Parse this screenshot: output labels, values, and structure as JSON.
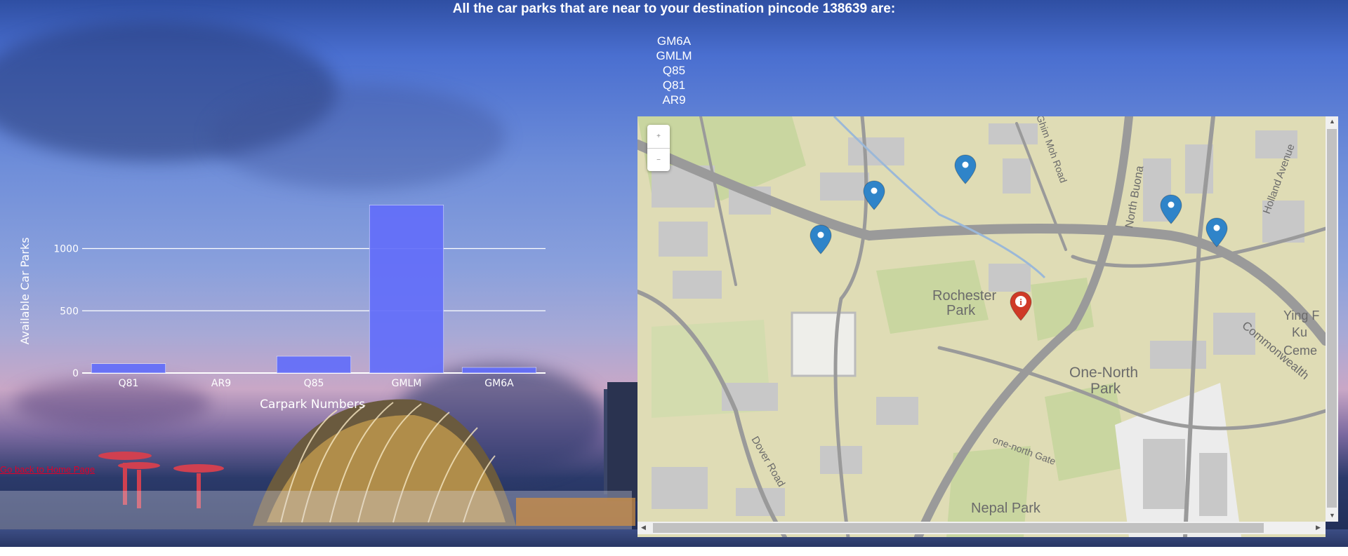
{
  "page": {
    "heading": "All the car parks that are near to your destination pincode 138639 are:",
    "carparks": [
      "GM6A",
      "GMLM",
      "Q85",
      "Q81",
      "AR9"
    ],
    "home_link": "Go back to Home Page"
  },
  "chart_data": {
    "type": "bar",
    "categories": [
      "Q81",
      "AR9",
      "Q85",
      "GMLM",
      "GM6A"
    ],
    "values": [
      75,
      0,
      135,
      1350,
      45
    ],
    "xlabel": "Carpark Numbers",
    "ylabel": "Available Car Parks",
    "yticks": [
      0,
      500,
      1000
    ],
    "ylim": [
      0,
      1420
    ],
    "grid": true,
    "bar_color": "#636efa"
  },
  "map": {
    "labels": {
      "rochester1": "Rochester",
      "rochester2": "Park",
      "onenorth1": "One-North",
      "onenorth2": "Park",
      "nepal": "Nepal Park",
      "dover": "Dover Road",
      "buona": "North Buona",
      "holland": "Holland Avenue",
      "commonwealth": "Commonwealth",
      "mohroad": "Ghim Moh Road",
      "onenorthgate": "one-north Gate",
      "yingfo": "Ying F",
      "ku": "Ku",
      "ceme": "Ceme"
    },
    "marker_color": "#2f84c9",
    "destination_color": "#cf3a27",
    "destination_icon": "i"
  },
  "colors": {
    "link": "#e0002a",
    "bar": "#636efa"
  }
}
